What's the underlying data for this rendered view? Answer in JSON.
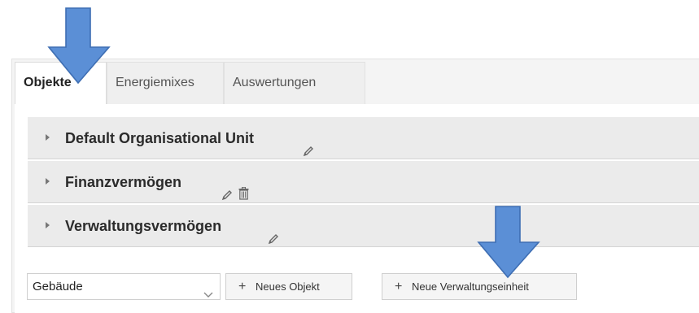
{
  "tabs": [
    {
      "label": "Objekte",
      "active": true
    },
    {
      "label": "Energiemixes",
      "active": false
    },
    {
      "label": "Auswertungen",
      "active": false
    }
  ],
  "units": [
    {
      "label": "Default Organisational Unit",
      "icons": [
        "pencil-icon"
      ]
    },
    {
      "label": "Finanzvermögen",
      "icons": [
        "pencil-icon",
        "trash-icon"
      ]
    },
    {
      "label": "Verwaltungsvermögen",
      "icons": [
        "pencil-icon"
      ]
    }
  ],
  "object_type": {
    "value": "Gebäude"
  },
  "buttons": {
    "new_object": "Neues Objekt",
    "new_admin_unit": "Neue Verwaltungseinheit"
  },
  "annotations": {
    "arrow_color": "#5b8fd6",
    "arrow_stroke": "#3e6eb3"
  }
}
